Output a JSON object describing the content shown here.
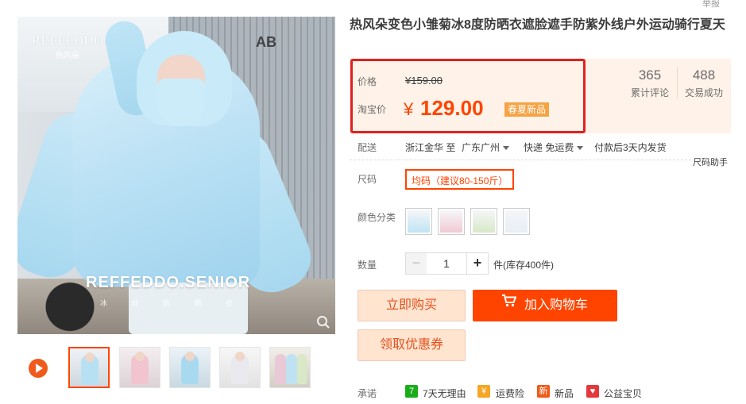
{
  "report_link": "举报",
  "gallery": {
    "brand_logo": "REFFEDDO",
    "brand_logo_sub": "热风朵",
    "watermark": "REFFEDDO.SENIOR",
    "watermark_sub": "冰 丝 防 晒 衣",
    "backdrop_text": "AB"
  },
  "product": {
    "title": "热风朵变色小雏菊冰8度防晒衣遮脸遮手防紫外线户外运动骑行夏天"
  },
  "price": {
    "price_label": "价格",
    "original_price": "¥159.00",
    "taobao_label": "淘宝价",
    "currency": "¥",
    "taobao_price": "129.00",
    "promo_badge": "春夏新品"
  },
  "stats": {
    "reviews_count": "365",
    "reviews_label": "累计评论",
    "sales_count": "488",
    "sales_label": "交易成功"
  },
  "delivery": {
    "label": "配送",
    "origin": "浙江金华 至",
    "destination": "广东广州",
    "shipping": "快递 免运费",
    "dispatch": "付款后3天内发货"
  },
  "size": {
    "helper": "尺码助手",
    "label": "尺码",
    "option": "均码（建议80-150斤）"
  },
  "color": {
    "label": "颜色分类",
    "swatch_colors": [
      "#bfe4f3",
      "#f2c9d3",
      "#d8e9c8",
      "#e8eef5"
    ]
  },
  "quantity": {
    "label": "数量",
    "minus": "−",
    "value": "1",
    "plus": "+",
    "stock": "件(库存400件)"
  },
  "actions": {
    "buy_now": "立即购买",
    "add_to_cart": "加入购物车",
    "coupon": "领取优惠券"
  },
  "promise": {
    "label": "承诺",
    "items": [
      {
        "icon": "7",
        "color": "#1aad19",
        "text": "7天无理由"
      },
      {
        "icon": "¥",
        "color": "#f5a623",
        "text": "运费险"
      },
      {
        "icon": "新",
        "color": "#f05a1a",
        "text": "新品"
      },
      {
        "icon": "♥",
        "color": "#e4393c",
        "text": "公益宝贝"
      }
    ]
  },
  "colors": {
    "accent": "#ff4400",
    "price": "#f40",
    "panel_bg": "#fff2e8",
    "highlight": "#e32020"
  },
  "icons": [
    "zoom-icon",
    "play-icon",
    "cart-icon",
    "caret-down-icon"
  ]
}
